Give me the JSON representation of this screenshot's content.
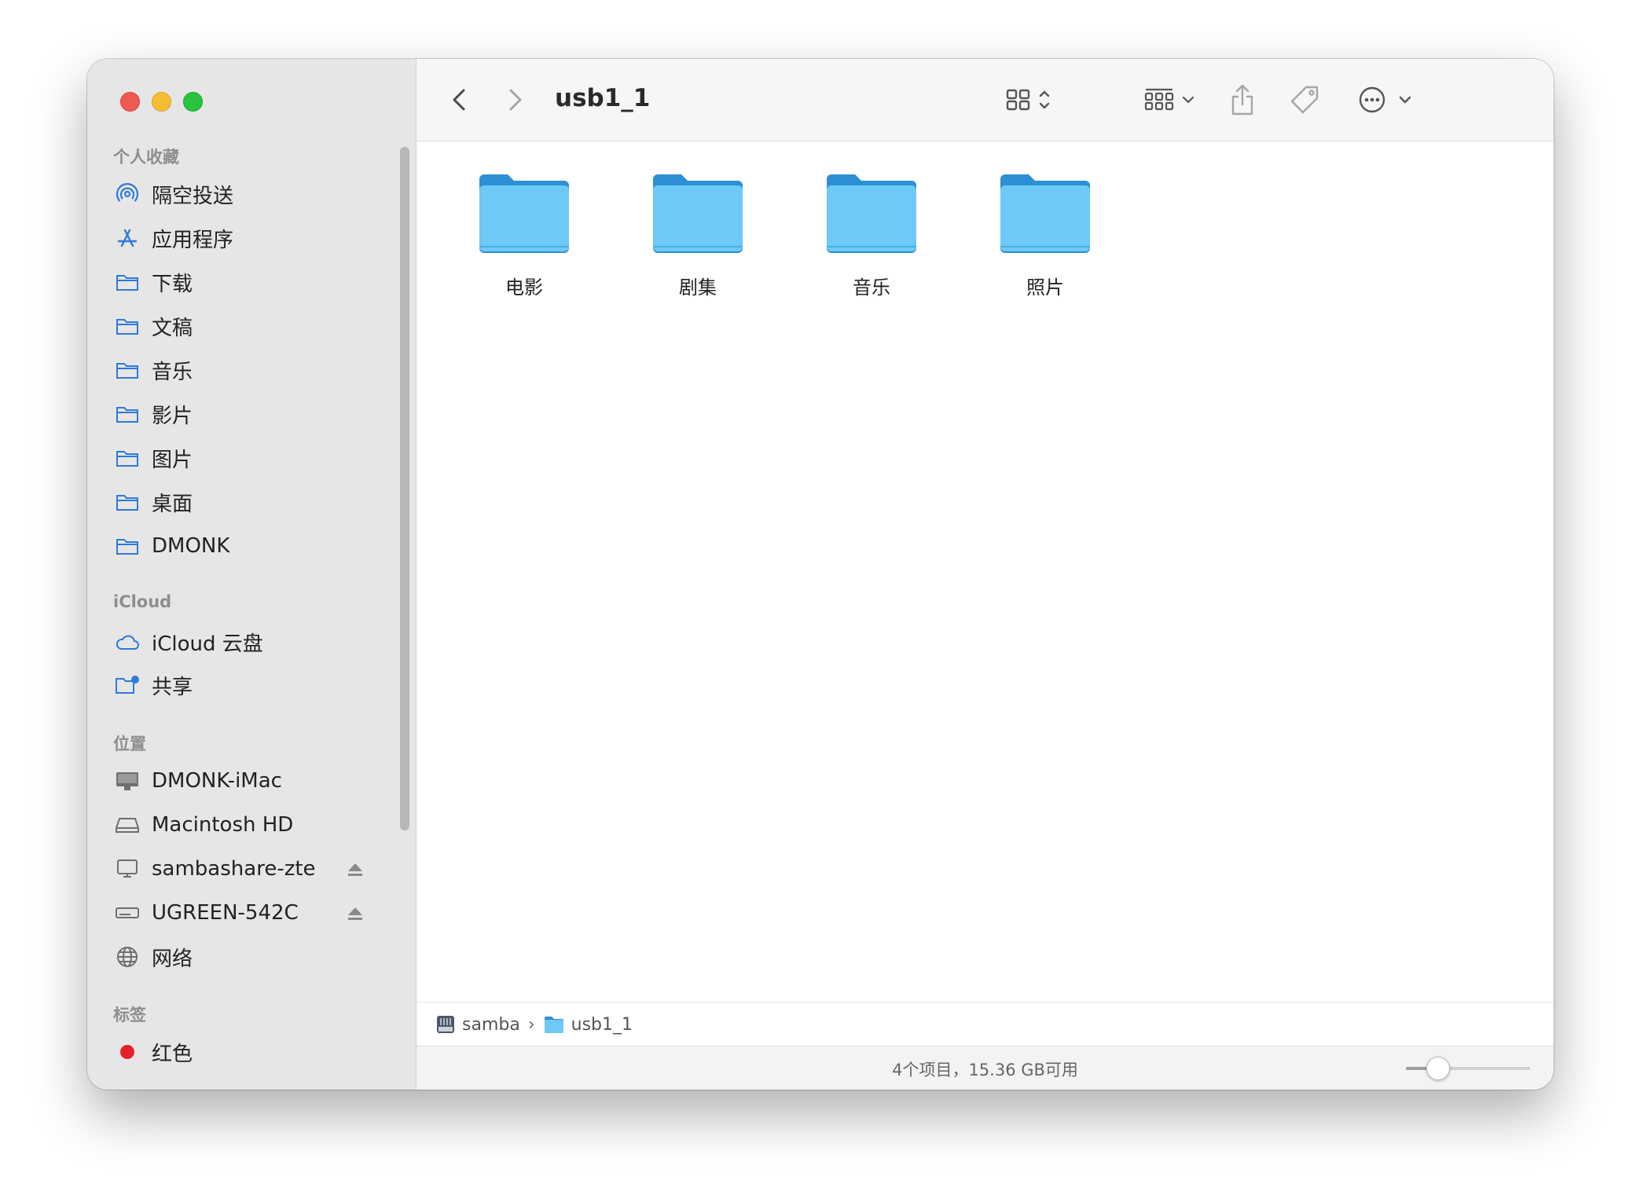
{
  "window": {
    "title": "usb1_1"
  },
  "sidebar": {
    "sections": {
      "favorites": "个人收藏",
      "icloud": "iCloud",
      "locations": "位置",
      "tags": "标签"
    },
    "favorites": [
      {
        "label": "隔空投送",
        "icon": "airdrop-icon"
      },
      {
        "label": "应用程序",
        "icon": "applications-icon"
      },
      {
        "label": "下载",
        "icon": "folder-icon"
      },
      {
        "label": "文稿",
        "icon": "folder-icon"
      },
      {
        "label": "音乐",
        "icon": "folder-icon"
      },
      {
        "label": "影片",
        "icon": "folder-icon"
      },
      {
        "label": "图片",
        "icon": "folder-icon"
      },
      {
        "label": "桌面",
        "icon": "folder-icon"
      },
      {
        "label": "DMONK",
        "icon": "folder-icon"
      }
    ],
    "icloud": [
      {
        "label": "iCloud 云盘",
        "icon": "icloud-icon"
      },
      {
        "label": "共享",
        "icon": "shared-folder-icon"
      }
    ],
    "locations": [
      {
        "label": "DMONK-iMac",
        "icon": "imac-icon"
      },
      {
        "label": "Macintosh HD",
        "icon": "harddisk-icon"
      },
      {
        "label": "sambashare-zte",
        "icon": "network-server-icon",
        "eject": true
      },
      {
        "label": "UGREEN-542C",
        "icon": "external-drive-icon",
        "eject": true
      },
      {
        "label": "网络",
        "icon": "network-globe-icon"
      }
    ],
    "tags": [
      {
        "label": "红色",
        "color": "#e5202a"
      }
    ]
  },
  "content": {
    "folders": [
      {
        "label": "电影"
      },
      {
        "label": "剧集"
      },
      {
        "label": "音乐"
      },
      {
        "label": "照片"
      }
    ]
  },
  "pathbar": {
    "segments": [
      {
        "label": "samba",
        "icon": "network-volume-icon"
      },
      {
        "label": "usb1_1",
        "icon": "folder-icon"
      }
    ]
  },
  "status": {
    "text": "4个项目，15.36 GB可用",
    "icon_size_level": 0.25
  },
  "colors": {
    "accent": "#2f7ad9",
    "folder": "#6ec9f7"
  }
}
